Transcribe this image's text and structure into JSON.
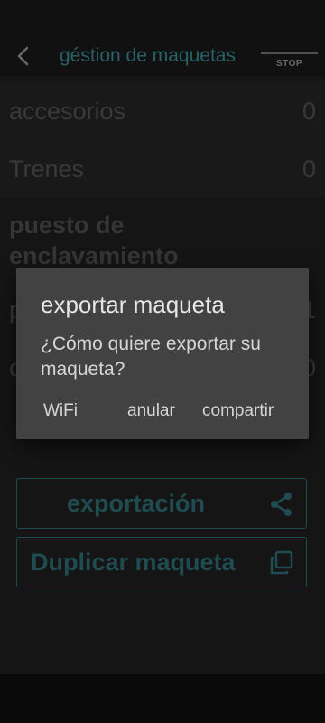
{
  "app_bar": {
    "title": "géstion de maquetas",
    "stop_label": "STOP"
  },
  "list": [
    {
      "label": "accesorios",
      "count": "0"
    },
    {
      "label": "Trenes",
      "count": "0"
    }
  ],
  "section": {
    "title": "puesto de enclavamiento",
    "hidden_row_1_initial": "p",
    "hidden_row_1_count": "1",
    "hidden_row_2_initial": "c",
    "hidden_row_2_count": "0"
  },
  "actions": {
    "export_label": "exportación",
    "duplicate_label": "Duplicar maqueta"
  },
  "dialog": {
    "title": "exportar maqueta",
    "message": "¿Cómo quiere exportar su maqueta?",
    "buttons": {
      "wifi": "WiFi",
      "cancel": "anular",
      "share": "compartir"
    }
  },
  "colors": {
    "accent": "#3f8f98",
    "background": "#1f1f1f",
    "dialog": "#424242"
  },
  "icons": {
    "back": "back-arrow-icon",
    "share": "share-icon",
    "duplicate": "copy-icon"
  }
}
